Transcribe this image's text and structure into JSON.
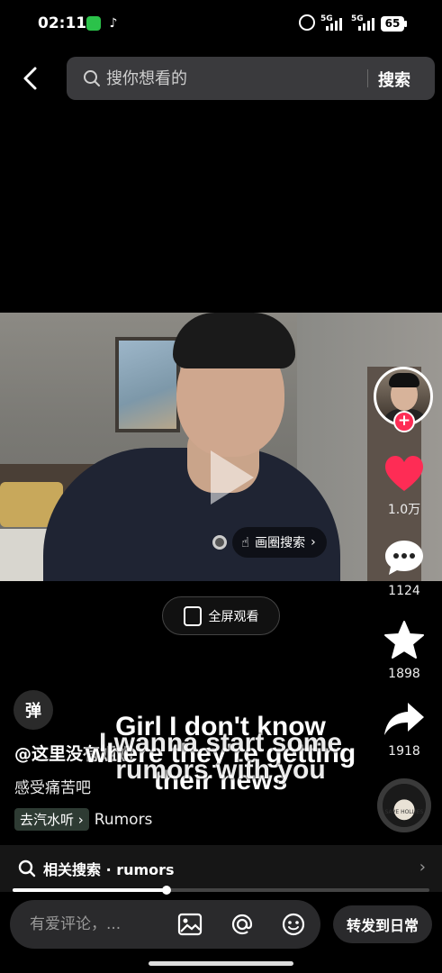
{
  "status_bar": {
    "time": "02:11",
    "signal_1": "5G",
    "signal_2": "5G",
    "battery": "65"
  },
  "search": {
    "placeholder": "搜你想看的",
    "submit_label": "搜索"
  },
  "video": {
    "circle_search_label": "画圈搜索",
    "fullscreen_label": "全屏观看"
  },
  "rail": {
    "likes": "1.0万",
    "comments": "1124",
    "favorites": "1898",
    "shares": "1918"
  },
  "danmu_label": "弹",
  "post": {
    "author": "@这里没有姐姐",
    "caption": "感受痛苦吧",
    "music_tag": "去汽水听 ›",
    "music_name": "Rumors",
    "lyric_line1": "Girl I don't know\nwhere they're getting\ntheir news",
    "lyric_line2": "I wanna start some\nrumors with you",
    "disc_text": "SAVE HOLLIES"
  },
  "related": {
    "label": "相关搜索 · rumors"
  },
  "progress": {
    "fraction": 0.37
  },
  "comment_bar": {
    "placeholder": "有爱评论，...",
    "forward_label": "转发到日常"
  },
  "colors": {
    "like": "#fe2c55",
    "music_tag_bg": "#2e3b33"
  }
}
